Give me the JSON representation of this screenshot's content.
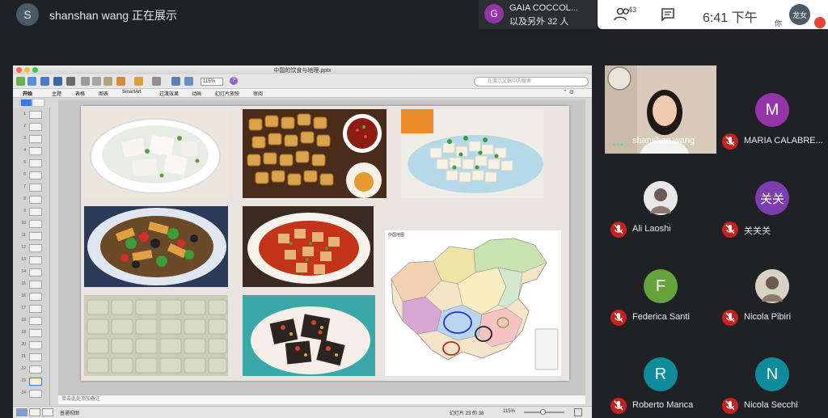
{
  "presenter": {
    "initial": "S",
    "text": "shanshan wang 正在展示"
  },
  "others": {
    "initial": "G",
    "name": "GAIA COCCOL...",
    "count": "以及另外 32 人"
  },
  "controls": {
    "people_icon": "people-icon",
    "people_count": "43",
    "chat_icon": "chat-icon",
    "clock": "6:41 下午",
    "self_label": "你",
    "self_name": "龙女"
  },
  "keynote": {
    "title": "中国的饮食与地理.pptx",
    "zoom": "115%",
    "search_placeholder": "在演示文稿中的搜索",
    "tabs": [
      "开始",
      "主题",
      "表格",
      "图表",
      "SmartArt",
      "过渡效果",
      "动画",
      "幻灯片放映",
      "审阅"
    ],
    "notes_placeholder": "单击此处添加备注",
    "status_view": "普通视图",
    "status_slide": "幻灯片 23 的 38",
    "status_zoom": "115%",
    "thumb_numbers": [
      "1",
      "2",
      "3",
      "4",
      "5",
      "6",
      "7",
      "8",
      "9",
      "10",
      "11",
      "12",
      "13",
      "14",
      "15",
      "16",
      "17",
      "18",
      "19",
      "20",
      "21",
      "22",
      "23",
      "24"
    ],
    "active_slide": "23",
    "map_title": "中国地图"
  },
  "participants": [
    {
      "name": "shanshan wang",
      "type": "video"
    },
    {
      "name": "MARIA CALABRE...",
      "initial": "M",
      "color": "#9334a8"
    },
    {
      "name": "Ali Laoshi",
      "initial": "",
      "color": "#e8e8e8",
      "photo": true
    },
    {
      "name": "关关关",
      "initial": "关关",
      "color": "#7b3db0"
    },
    {
      "name": "Federica Santi",
      "initial": "F",
      "color": "#66a33d"
    },
    {
      "name": "Nicola Pibiri",
      "initial": "",
      "color": "#d8d2c4",
      "photo": true
    },
    {
      "name": "Roberto Manca",
      "initial": "R",
      "color": "#0f8c9c"
    },
    {
      "name": "Nicola Secchi",
      "initial": "N",
      "color": "#0f8c9c"
    }
  ]
}
